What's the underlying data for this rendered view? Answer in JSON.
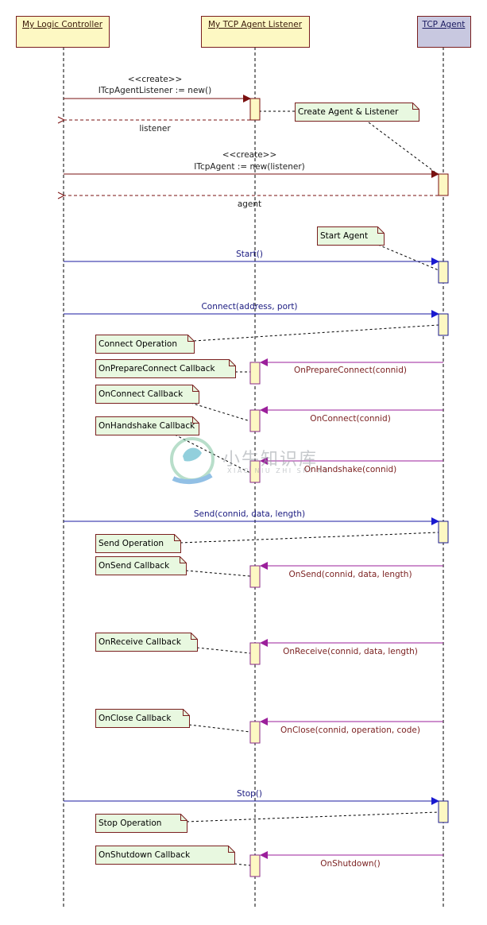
{
  "participants": [
    {
      "id": "controller",
      "label": "My Logic Controller",
      "fill": "#fdf8c3"
    },
    {
      "id": "listener",
      "label": "My TCP Agent Listener",
      "fill": "#fdf8c3"
    },
    {
      "id": "agent",
      "label": "TCP Agent",
      "fill": "#c8c8e0"
    }
  ],
  "messages": [
    {
      "from": "controller",
      "to": "listener",
      "kind": "create",
      "stereotype": "<<create>>",
      "label": "ITcpAgentListener := new()",
      "color": "#7a1010"
    },
    {
      "from": "listener",
      "to": "controller",
      "kind": "return",
      "label": "listener",
      "color": "#7a1010"
    },
    {
      "from": "controller",
      "to": "agent",
      "kind": "create",
      "stereotype": "<<create>>",
      "label": "ITcpAgent := new(listener)",
      "color": "#7a1010"
    },
    {
      "from": "agent",
      "to": "controller",
      "kind": "return",
      "label": "agent",
      "color": "#7a1010"
    },
    {
      "from": "controller",
      "to": "agent",
      "kind": "call",
      "label": "Start()",
      "color": "#1a1aa0"
    },
    {
      "from": "controller",
      "to": "agent",
      "kind": "call",
      "label": "Connect(address, port)",
      "color": "#1a1aa0"
    },
    {
      "from": "agent",
      "to": "listener",
      "kind": "callback",
      "label": "OnPrepareConnect(connid)",
      "color": "#9b1f9b"
    },
    {
      "from": "agent",
      "to": "listener",
      "kind": "callback",
      "label": "OnConnect(connid)",
      "color": "#9b1f9b"
    },
    {
      "from": "agent",
      "to": "listener",
      "kind": "callback",
      "label": "OnHandshake(connid)",
      "color": "#9b1f9b"
    },
    {
      "from": "controller",
      "to": "agent",
      "kind": "call",
      "label": "Send(connid, data, length)",
      "color": "#1a1aa0"
    },
    {
      "from": "agent",
      "to": "listener",
      "kind": "callback",
      "label": "OnSend(connid, data, length)",
      "color": "#9b1f9b"
    },
    {
      "from": "agent",
      "to": "listener",
      "kind": "callback",
      "label": "OnReceive(connid, data, length)",
      "color": "#9b1f9b"
    },
    {
      "from": "agent",
      "to": "listener",
      "kind": "callback",
      "label": "OnClose(connid, operation, code)",
      "color": "#9b1f9b"
    },
    {
      "from": "controller",
      "to": "agent",
      "kind": "call",
      "label": "Stop()",
      "color": "#1a1aa0"
    },
    {
      "from": "agent",
      "to": "listener",
      "kind": "callback",
      "label": "OnShutdown()",
      "color": "#9b1f9b"
    }
  ],
  "notes": [
    {
      "text": "Create Agent & Listener"
    },
    {
      "text": "Start Agent"
    },
    {
      "text": "Connect Operation"
    },
    {
      "text": "OnPrepareConnect Callback"
    },
    {
      "text": "OnConnect Callback"
    },
    {
      "text": "OnHandshake Callback"
    },
    {
      "text": "Send Operation"
    },
    {
      "text": "OnSend Callback"
    },
    {
      "text": "OnReceive Callback"
    },
    {
      "text": "OnClose Callback"
    },
    {
      "text": "Stop Operation"
    },
    {
      "text": "OnShutdown Callback"
    }
  ],
  "colors": {
    "header_border": "#7a1f1f",
    "activation_fill": "#fdf8c3",
    "note_fill": "#e8f8e0",
    "note_border": "#7a1f1f",
    "create_text": "#222222",
    "return_text": "#222222",
    "call_text": "#1a1a80",
    "callback_text": "#7a1f1f"
  },
  "watermark": {
    "title": "小牛知识库",
    "subtitle": "XIAO NIU ZHI SHI KU"
  }
}
